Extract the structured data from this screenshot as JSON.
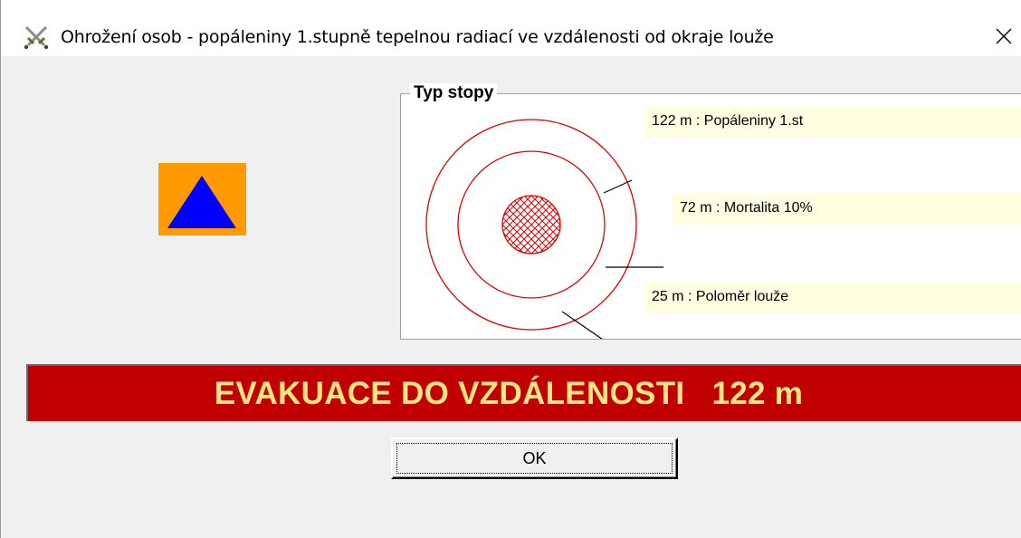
{
  "window": {
    "title": "Ohrožení osob - popáleniny 1.stupně tepelnou radiací ve vzdálenosti od okraje louže",
    "app_icon": "crossed-swords-icon",
    "close_glyph": "✕"
  },
  "warning_sign": {
    "icon": "blue-triangle-on-orange",
    "colors": {
      "background": "#ff9a00",
      "triangle": "#0000ff"
    }
  },
  "footprint": {
    "title": "Typ stopy",
    "zones": [
      {
        "label": "122 m : Popáleniny 1.st"
      },
      {
        "label": "72 m : Mortalita 10%"
      },
      {
        "label": "25 m : Poloměr louže"
      }
    ],
    "colors": {
      "rings": "#e00000",
      "label_bg": "#ffffe1"
    }
  },
  "evacuation": {
    "text": "EVAKUACE DO VZDÁLENOSTI   122 m",
    "colors": {
      "background": "#c00000",
      "text": "#ffe680"
    }
  },
  "ok_button": {
    "label": "OK"
  }
}
